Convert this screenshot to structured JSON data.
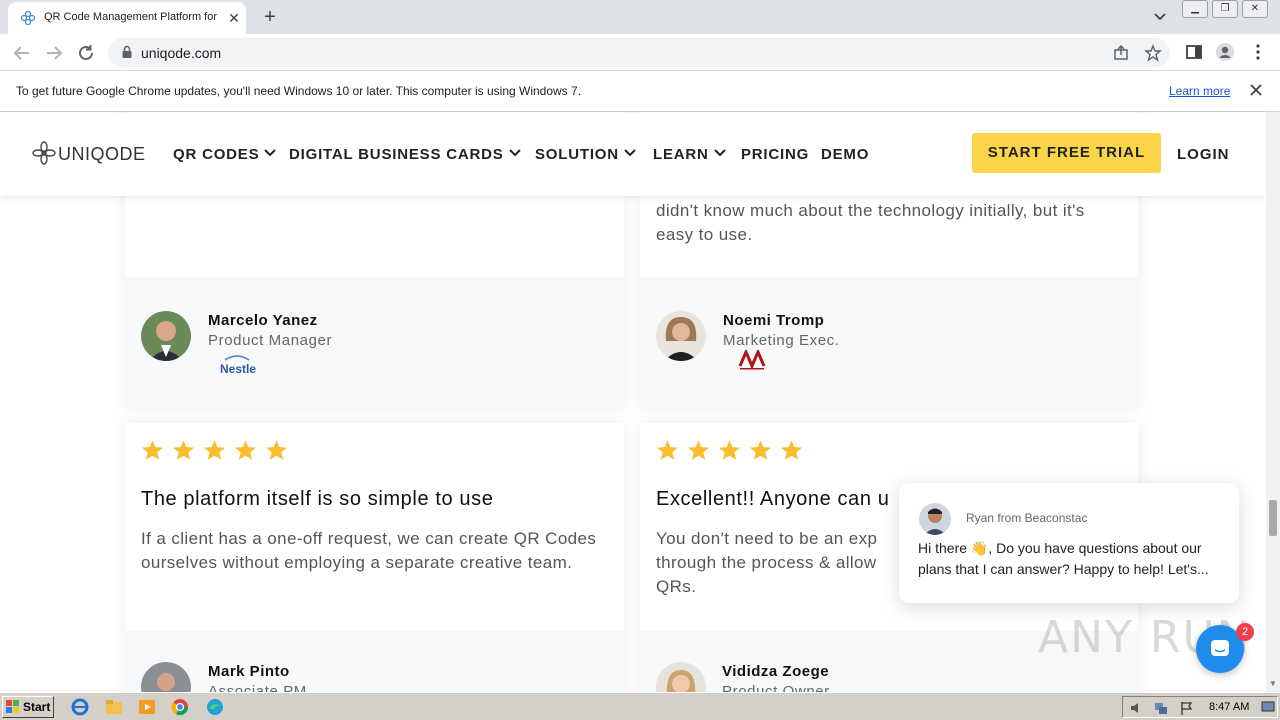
{
  "browser": {
    "tab_title": "QR Code Management Platform for n",
    "url": "uniqode.com",
    "new_tab_label": "+",
    "close_tab_label": "✕"
  },
  "infobar": {
    "message": "To get future Google Chrome updates, you'll need Windows 10 or later. This computer is using Windows 7.",
    "learn_more": "Learn more"
  },
  "site": {
    "logo_text": "UNIQODE",
    "nav": [
      {
        "label": "QR CODES",
        "has_dropdown": true
      },
      {
        "label": "DIGITAL BUSINESS CARDS",
        "has_dropdown": true
      },
      {
        "label": "SOLUTION",
        "has_dropdown": true
      },
      {
        "label": "LEARN",
        "has_dropdown": true
      },
      {
        "label": "PRICING",
        "has_dropdown": false
      },
      {
        "label": "DEMO",
        "has_dropdown": false
      }
    ],
    "cta": "START FREE TRIAL",
    "login": "LOGIN",
    "accent_color": "#fbd44a"
  },
  "testimonials": [
    {
      "quote": "",
      "name": "Marcelo Yanez",
      "role": "Product Manager",
      "company_logo": "Nestle"
    },
    {
      "quote": "didn't know much about the technology initially, but it's easy to use.",
      "name": "Noemi Tromp",
      "role": "Marketing Exec.",
      "company_logo": "marriott-logo"
    },
    {
      "rating": 5,
      "heading": "The platform itself is so simple to use",
      "quote": "If a client has a one-off request, we can create QR Codes ourselves without employing a separate creative team.",
      "name": "Mark Pinto",
      "role": "Associate PM"
    },
    {
      "rating": 5,
      "heading": "Excellent!! Anyone can u",
      "quote": "You don't need to be an exp through the process & allow QRs.",
      "name": "Vididza Zoege",
      "role": "Product Owner"
    }
  ],
  "chat": {
    "from": "Ryan from Beaconstac",
    "message": "Hi there 👋,  Do you have questions about our plans that I can answer? Happy to help! Let's...",
    "badge_count": "2"
  },
  "watermark": "ANY RUN",
  "taskbar": {
    "start_label": "Start",
    "time": "8:47 AM"
  }
}
